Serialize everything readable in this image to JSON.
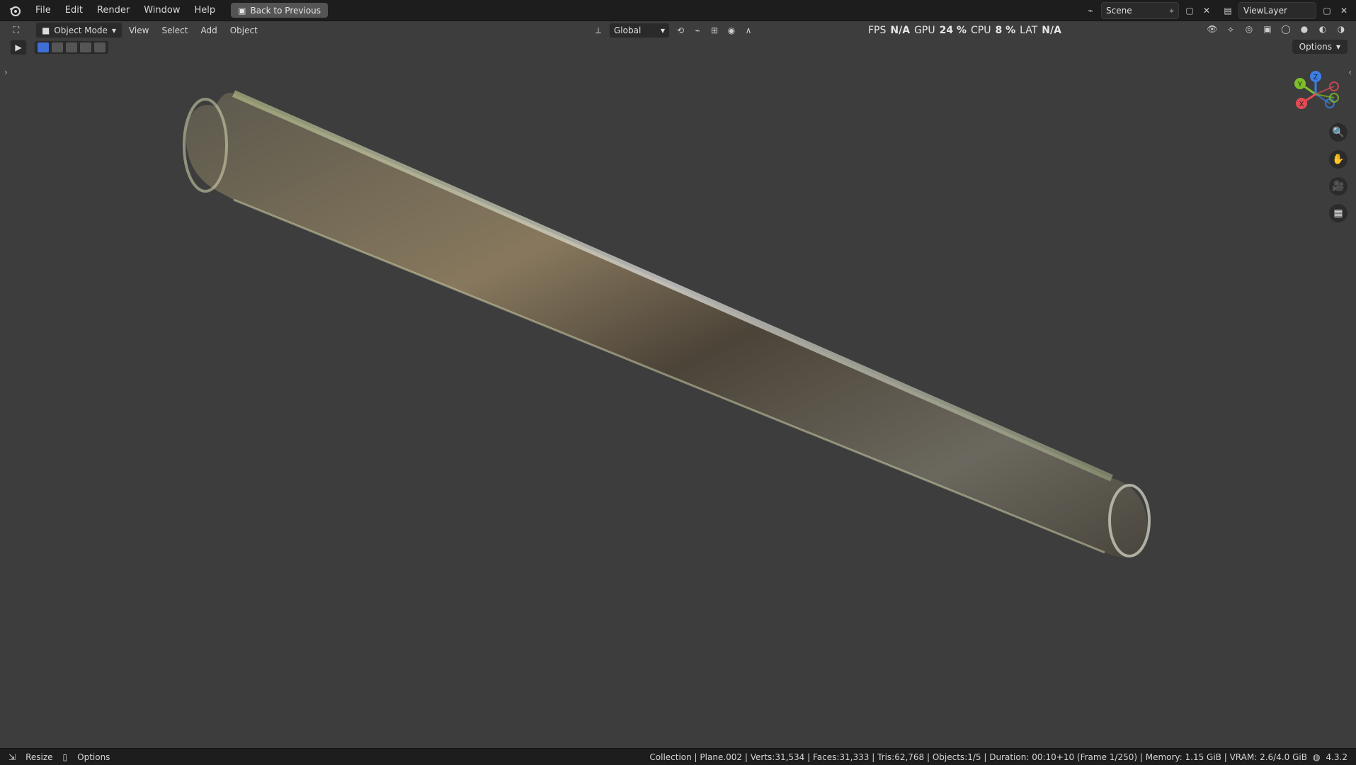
{
  "topbar": {
    "menu": [
      {
        "label": "File"
      },
      {
        "label": "Edit"
      },
      {
        "label": "Render"
      },
      {
        "label": "Window"
      },
      {
        "label": "Help"
      }
    ],
    "back_to_previous": "Back to Previous",
    "scene_label": "Scene",
    "view_layer_label": "ViewLayer"
  },
  "header": {
    "mode_label": "Object Mode",
    "menu": [
      {
        "label": "View"
      },
      {
        "label": "Select"
      },
      {
        "label": "Add"
      },
      {
        "label": "Object"
      }
    ],
    "transform_orientation": "Global",
    "options_label": "Options",
    "stats": {
      "fps_label": "FPS",
      "fps_value": "N/A",
      "gpu_label": "GPU",
      "gpu_value": "24 %",
      "cpu_label": "CPU",
      "cpu_value": "8 %",
      "lat_label": "LAT",
      "lat_value": "N/A"
    }
  },
  "gizmo": {
    "y": "Y",
    "z": "Z",
    "x": "X",
    "colors": {
      "x": "#e44a55",
      "y": "#7fbf2a",
      "z": "#3b7fe6"
    }
  },
  "statusbar": {
    "resize": "Resize",
    "options": "Options",
    "info": "Collection | Plane.002 | Verts:31,534 | Faces:31,333 | Tris:62,768 | Objects:1/5 | Duration: 00:10+10 (Frame 1/250) | Memory: 1.15 GiB | VRAM: 2.6/4.0 GiB",
    "version": "4.3.2"
  },
  "icons": {
    "blender": "blender-logo-icon",
    "search": "search-icon",
    "hand": "hand-icon",
    "camera": "camera-icon",
    "grid": "grid-icon"
  }
}
